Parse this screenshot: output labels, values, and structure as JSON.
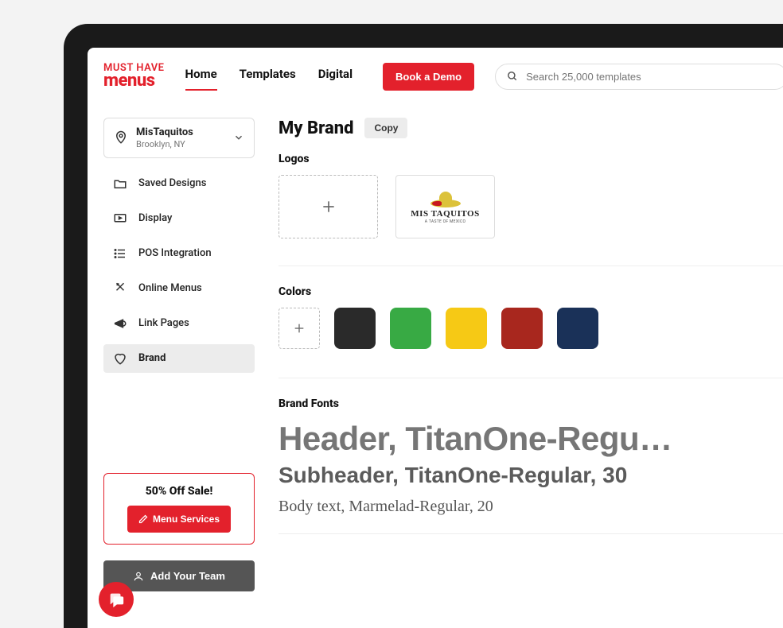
{
  "brand": {
    "logo_line1": "MUST HAVE",
    "logo_line2": "menus"
  },
  "nav": {
    "items": [
      "Home",
      "Templates",
      "Digital"
    ],
    "active_index": 0,
    "cta": "Book a Demo"
  },
  "search": {
    "placeholder": "Search 25,000 templates"
  },
  "location": {
    "name": "MisTaquitos",
    "sub": "Brooklyn, NY"
  },
  "sidebar": {
    "items": [
      {
        "icon": "folder",
        "label": "Saved Designs"
      },
      {
        "icon": "display",
        "label": "Display"
      },
      {
        "icon": "list",
        "label": "POS Integration"
      },
      {
        "icon": "utensils",
        "label": "Online Menus"
      },
      {
        "icon": "megaphone",
        "label": "Link Pages"
      },
      {
        "icon": "heart",
        "label": "Brand"
      }
    ],
    "active_index": 5
  },
  "promo": {
    "title": "50% Off Sale!",
    "button": "Menu Services"
  },
  "team_button": "Add Your Team",
  "main": {
    "title": "My Brand",
    "copy": "Copy",
    "sections": {
      "logos": "Logos",
      "colors": "Colors",
      "fonts": "Brand Fonts"
    },
    "logo_card": {
      "text": "MIS TAQUITOS",
      "sub": "A TASTE OF MEXICO"
    },
    "colors": [
      "#2a2a2a",
      "#38aa44",
      "#f6c915",
      "#a8271e",
      "#1a3158"
    ],
    "fonts": {
      "header": "Header, TitanOne-Regu…",
      "subheader": "Subheader, TitanOne-Regular, 30",
      "body": "Body text, Marmelad-Regular, 20"
    }
  }
}
